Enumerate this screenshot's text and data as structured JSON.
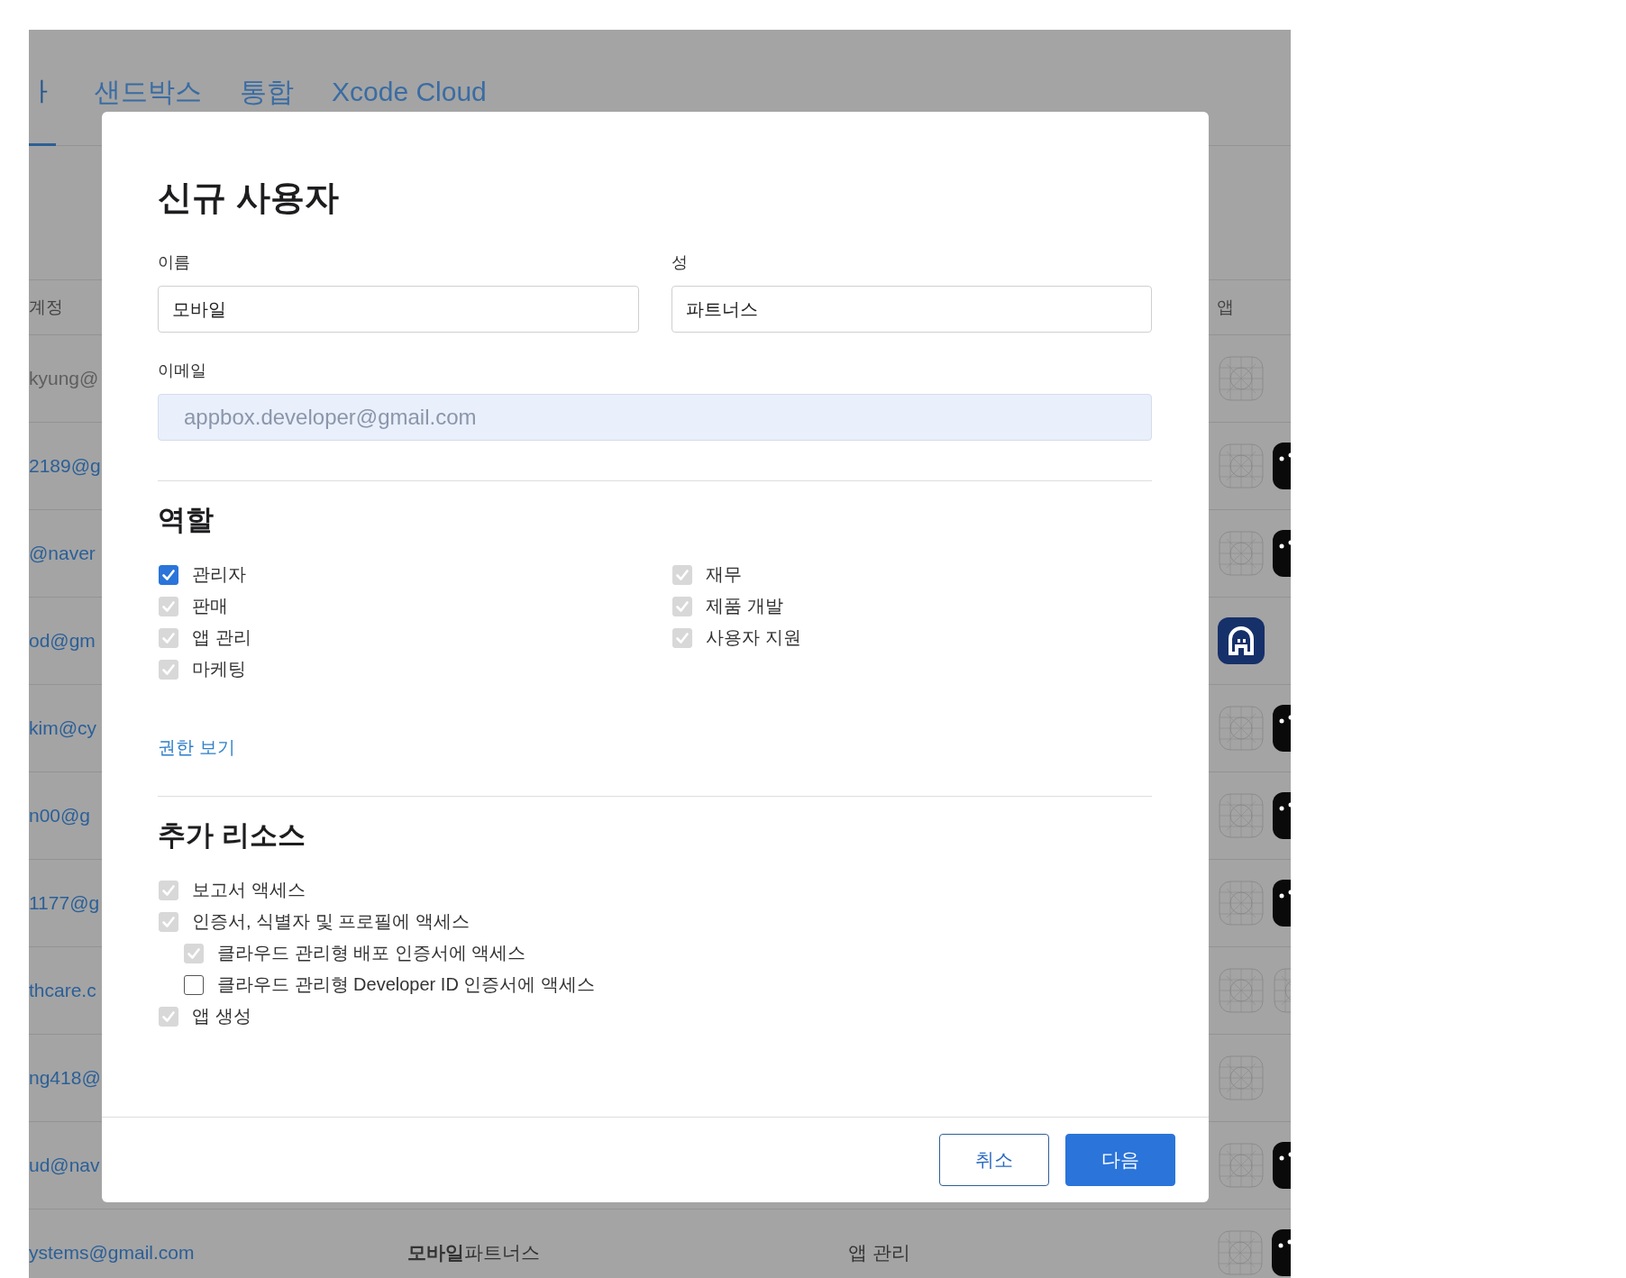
{
  "background": {
    "tabs": [
      {
        "label": "ㅏ",
        "selected": true
      },
      {
        "label": "샌드박스",
        "selected": false
      },
      {
        "label": "통합",
        "selected": false
      },
      {
        "label": "Xcode Cloud",
        "selected": false
      }
    ],
    "table": {
      "columns": [
        "계정",
        "앱"
      ],
      "rows": [
        {
          "account": "kyung@",
          "kind": "plain",
          "apps": [
            {
              "kind": "placeholder"
            }
          ]
        },
        {
          "account": "2189@g",
          "kind": "link",
          "apps": [
            {
              "kind": "placeholder"
            },
            {
              "kind": "dark"
            }
          ]
        },
        {
          "account": "@naver",
          "kind": "link",
          "apps": [
            {
              "kind": "placeholder"
            },
            {
              "kind": "dark"
            }
          ]
        },
        {
          "account": "od@gm",
          "kind": "link",
          "apps": [
            {
              "kind": "brand"
            }
          ]
        },
        {
          "account": "kim@cy",
          "kind": "link",
          "apps": [
            {
              "kind": "placeholder"
            },
            {
              "kind": "dark"
            }
          ]
        },
        {
          "account": "n00@g",
          "kind": "link",
          "apps": [
            {
              "kind": "placeholder"
            },
            {
              "kind": "dark"
            }
          ]
        },
        {
          "account": "1177@g",
          "kind": "link",
          "apps": [
            {
              "kind": "placeholder"
            },
            {
              "kind": "dark"
            }
          ]
        },
        {
          "account": "thcare.c",
          "kind": "link",
          "apps": [
            {
              "kind": "placeholder"
            },
            {
              "kind": "placeholder"
            }
          ]
        },
        {
          "account": "ng418@",
          "kind": "link",
          "apps": [
            {
              "kind": "placeholder"
            }
          ]
        },
        {
          "account": "ud@nav",
          "kind": "link",
          "apps": [
            {
              "kind": "placeholder"
            },
            {
              "kind": "dark"
            }
          ]
        },
        {
          "account": "ystems@gmail.com",
          "kind": "link",
          "name": "**모바일**파트너스",
          "role": "앱 관리",
          "apps": [
            {
              "kind": "placeholder"
            },
            {
              "kind": "dark"
            }
          ]
        }
      ]
    }
  },
  "dialog": {
    "title": "신규 사용자",
    "first_name": {
      "label": "이름",
      "value": "모바일"
    },
    "last_name": {
      "label": "성",
      "value": "파트너스"
    },
    "email": {
      "label": "이메일",
      "value": "appbox.developer@gmail.com",
      "disabled": true
    },
    "roles": {
      "title": "역할",
      "columns": [
        [
          {
            "label": "관리자",
            "checked": true,
            "disabled": false
          },
          {
            "label": "판매",
            "checked": true,
            "disabled": true
          },
          {
            "label": "앱 관리",
            "checked": true,
            "disabled": true
          },
          {
            "label": "마케팅",
            "checked": true,
            "disabled": true
          }
        ],
        [
          {
            "label": "재무",
            "checked": true,
            "disabled": true
          },
          {
            "label": "제품 개발",
            "checked": true,
            "disabled": true
          },
          {
            "label": "사용자 지원",
            "checked": true,
            "disabled": true
          }
        ]
      ],
      "link": "권한 보기"
    },
    "resources": {
      "title": "추가 리소스",
      "items": [
        {
          "label": "보고서 액세스",
          "checked": true,
          "disabled": true
        },
        {
          "label": "인증서, 식별자 및 프로필에 액세스",
          "checked": true,
          "disabled": true,
          "children": [
            {
              "label": "클라우드 관리형 배포 인증서에 액세스",
              "checked": true,
              "disabled": true
            },
            {
              "label": "클라우드 관리형 Developer ID 인증서에 액세스",
              "checked": false,
              "disabled": false
            }
          ]
        },
        {
          "label": "앱 생성",
          "checked": true,
          "disabled": true
        }
      ]
    },
    "buttons": [
      {
        "label": "취소",
        "kind": "secondary"
      },
      {
        "label": "다음",
        "kind": "primary"
      }
    ]
  }
}
